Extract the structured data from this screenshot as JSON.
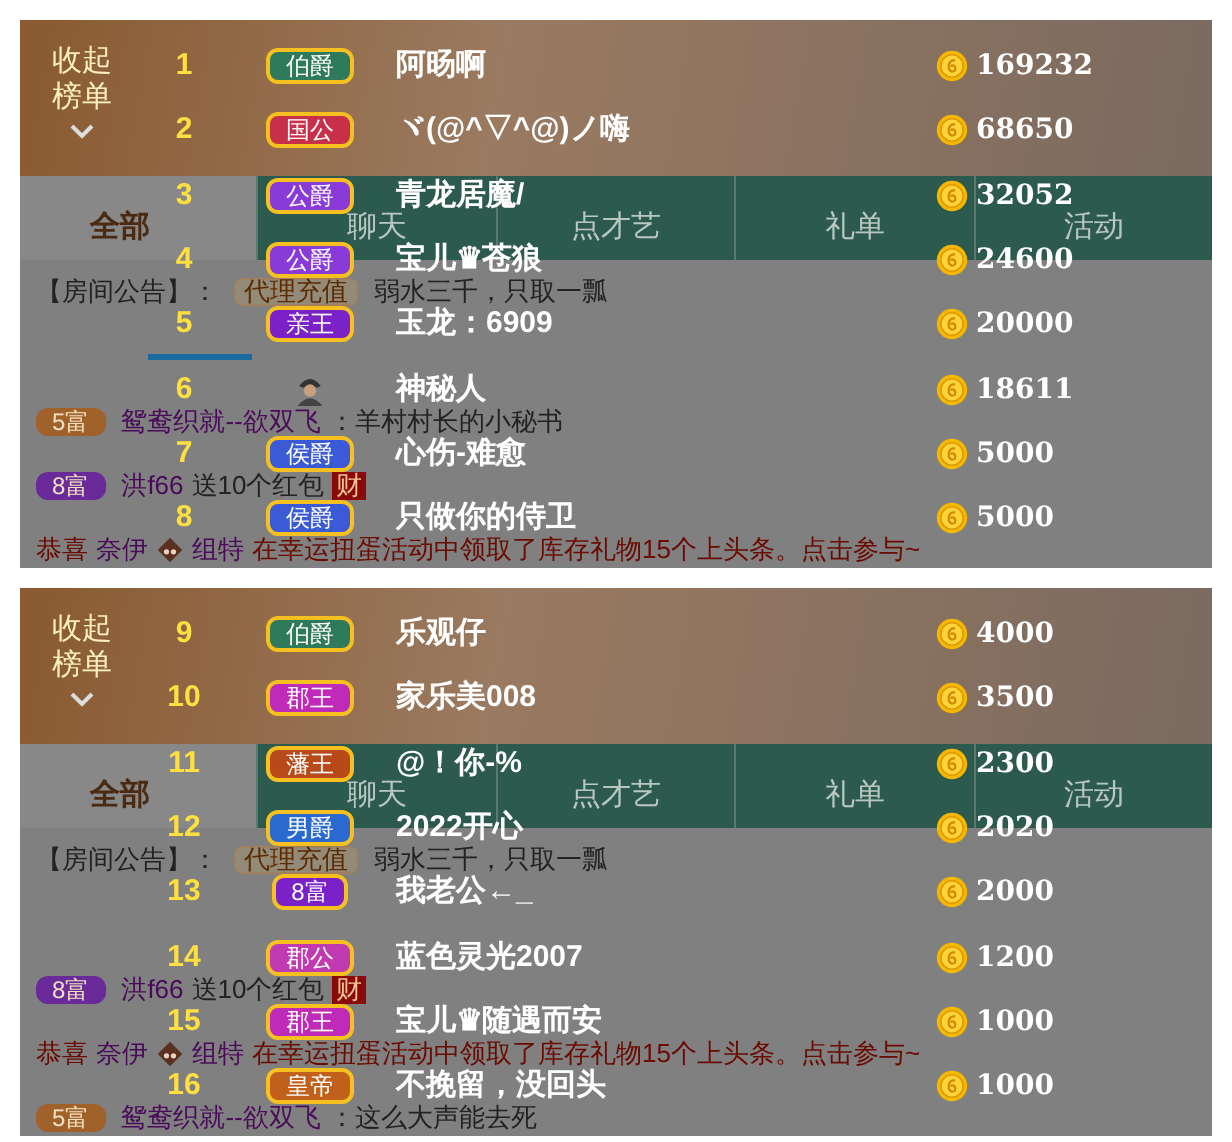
{
  "panels": [
    {
      "collapse_button": "收起榜单",
      "tabs": [
        {
          "label": "全部",
          "selected": true
        },
        {
          "label": "聊天",
          "selected": false
        },
        {
          "label": "点才艺",
          "selected": false
        },
        {
          "label": "礼单",
          "selected": false
        },
        {
          "label": "活动",
          "selected": false
        }
      ],
      "chat": [
        {
          "kind": "text",
          "segments": [
            {
              "kind": "plain",
              "text": "【房间公告】："
            },
            {
              "kind": "button",
              "text": "代理充值"
            },
            {
              "kind": "plain",
              "text": "弱水三千，只取一瓢"
            }
          ]
        },
        {
          "kind": "bar"
        },
        {
          "kind": "text",
          "badge": {
            "label": "5富",
            "color": "#a0622a"
          },
          "segments": [
            {
              "kind": "name",
              "text": "鸳鸯织就--欲双飞"
            },
            {
              "kind": "plain",
              "text": "：羊村村长的小秘书"
            }
          ]
        },
        {
          "kind": "text",
          "badge": {
            "label": "8富",
            "color": "#6a2a9a"
          },
          "segments": [
            {
              "kind": "name",
              "text": "洪f66"
            },
            {
              "kind": "plain",
              "text": "送10个红包"
            },
            {
              "kind": "tag",
              "text": "财"
            }
          ]
        },
        {
          "kind": "text",
          "segments": [
            {
              "kind": "alert",
              "text": "恭喜"
            },
            {
              "kind": "name",
              "text": "奈伊"
            },
            {
              "kind": "icon"
            },
            {
              "kind": "name",
              "text": "组特"
            },
            {
              "kind": "alert",
              "text": "在幸运扭蛋活动中领取了库存礼物15个上头条。点击参与~"
            }
          ]
        }
      ],
      "ranking": [
        {
          "rank": "1",
          "kind": "badge",
          "title": "伯爵",
          "color": "#2f7a5a",
          "name": "阿旸啊",
          "score": "169232"
        },
        {
          "rank": "2",
          "kind": "badge",
          "title": "国公",
          "color": "#c8304a",
          "name": "ヾ(@^▽^@)ノ嗨",
          "score": "68650"
        },
        {
          "rank": "3",
          "kind": "badge",
          "title": "公爵",
          "color": "#8a3ad8",
          "name": "青龙居魔/",
          "score": "32052"
        },
        {
          "rank": "4",
          "kind": "badge",
          "title": "公爵",
          "color": "#8a3ad8",
          "name": "宝儿♛苍狼",
          "score": "24600"
        },
        {
          "rank": "5",
          "kind": "badge",
          "title": "亲王",
          "color": "#7a22c8",
          "name": "玉龙：6909",
          "score": "20000"
        },
        {
          "rank": "6",
          "kind": "anonymous",
          "name": "神秘人",
          "score": "18611"
        },
        {
          "rank": "7",
          "kind": "badge",
          "title": "侯爵",
          "color": "#3a5ad8",
          "name": "心伤-难愈",
          "score": "5000"
        },
        {
          "rank": "8",
          "kind": "badge",
          "title": "侯爵",
          "color": "#3a5ad8",
          "name": "只做你的侍卫",
          "score": "5000"
        }
      ]
    },
    {
      "collapse_button": "收起榜单",
      "tabs": [
        {
          "label": "全部",
          "selected": true
        },
        {
          "label": "聊天",
          "selected": false
        },
        {
          "label": "点才艺",
          "selected": false
        },
        {
          "label": "礼单",
          "selected": false
        },
        {
          "label": "活动",
          "selected": false
        }
      ],
      "chat": [
        {
          "kind": "text",
          "segments": [
            {
              "kind": "plain",
              "text": "【房间公告】："
            },
            {
              "kind": "button",
              "text": "代理充值"
            },
            {
              "kind": "plain",
              "text": "弱水三千，只取一瓢"
            }
          ]
        },
        {
          "kind": "spacer"
        },
        {
          "kind": "text",
          "badge": {
            "label": "8富",
            "color": "#6a2a9a"
          },
          "segments": [
            {
              "kind": "name",
              "text": "洪f66"
            },
            {
              "kind": "plain",
              "text": "送10个红包"
            },
            {
              "kind": "tag",
              "text": "财"
            }
          ]
        },
        {
          "kind": "text",
          "segments": [
            {
              "kind": "alert",
              "text": "恭喜"
            },
            {
              "kind": "name",
              "text": "奈伊"
            },
            {
              "kind": "icon"
            },
            {
              "kind": "name",
              "text": "组特"
            },
            {
              "kind": "alert",
              "text": "在幸运扭蛋活动中领取了库存礼物15个上头条。点击参与~"
            }
          ]
        },
        {
          "kind": "text",
          "badge": {
            "label": "5富",
            "color": "#a0622a"
          },
          "segments": [
            {
              "kind": "name",
              "text": "鸳鸯织就--欲双飞"
            },
            {
              "kind": "plain",
              "text": "：这么大声能去死"
            }
          ]
        }
      ],
      "ranking": [
        {
          "rank": "9",
          "kind": "badge",
          "title": "伯爵",
          "color": "#2f7a5a",
          "name": "乐观仔",
          "score": "4000"
        },
        {
          "rank": "10",
          "kind": "badge",
          "title": "郡王",
          "color": "#c02ab8",
          "name": "家乐美008",
          "score": "3500"
        },
        {
          "rank": "11",
          "kind": "badge",
          "title": "藩王",
          "color": "#b84a1a",
          "name": "@！你-%",
          "score": "2300"
        },
        {
          "rank": "12",
          "kind": "badge",
          "title": "男爵",
          "color": "#2a6ad0",
          "name": "2022开心",
          "score": "2020"
        },
        {
          "rank": "13",
          "kind": "badge",
          "title": "8富",
          "color": "#7a22c8",
          "name": "我老公←_",
          "score": "2000"
        },
        {
          "rank": "14",
          "kind": "badge",
          "title": "郡公",
          "color": "#c03ab0",
          "name": "蓝色灵光2007",
          "score": "1200"
        },
        {
          "rank": "15",
          "kind": "badge",
          "title": "郡王",
          "color": "#c02ab8",
          "name": "宝儿♛随遇而安",
          "score": "1000"
        },
        {
          "rank": "16",
          "kind": "badge",
          "title": "皇帝",
          "color": "#c0601a",
          "name": "不挽留，没回头",
          "score": "1000"
        }
      ]
    }
  ]
}
